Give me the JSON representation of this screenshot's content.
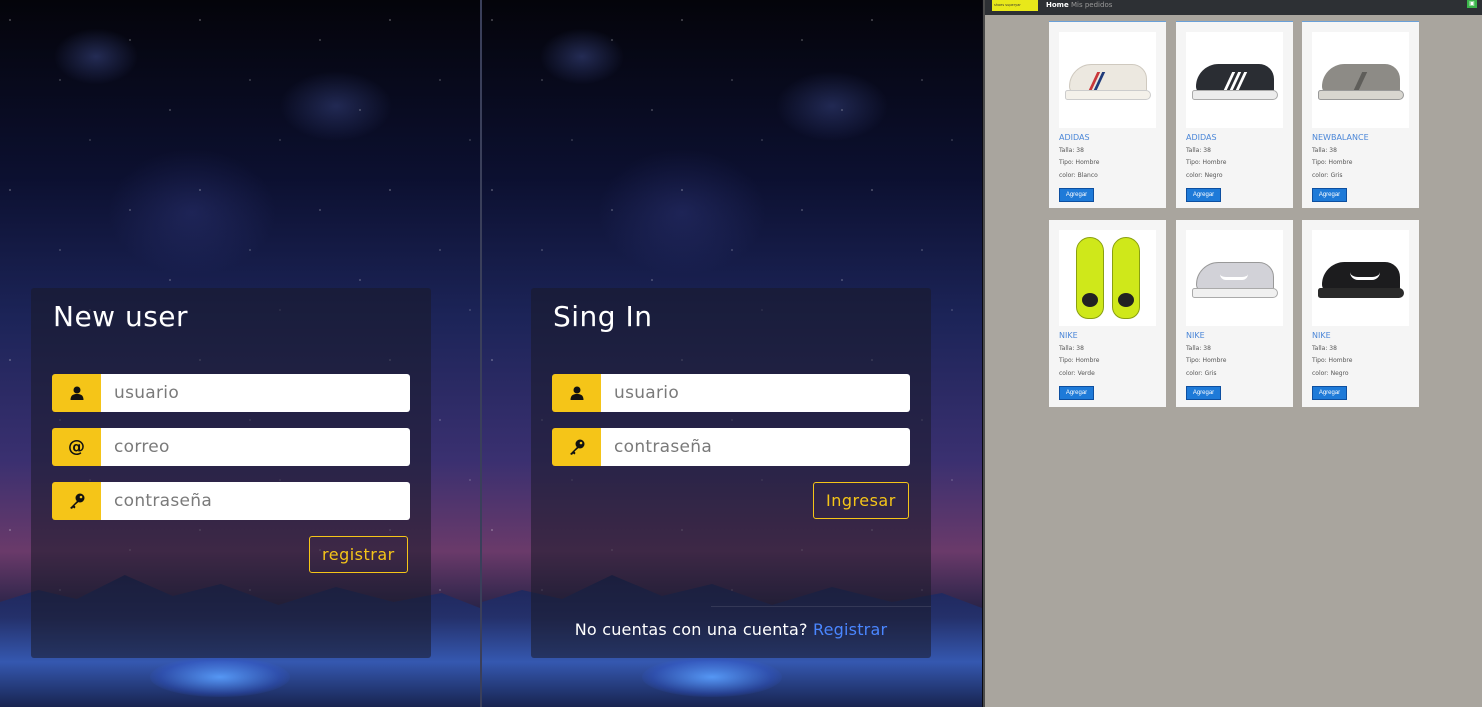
{
  "register": {
    "title": "New user",
    "username_placeholder": "usuario",
    "email_placeholder": "correo",
    "password_placeholder": "contraseña",
    "submit_label": "registrar"
  },
  "login": {
    "title": "Sing In",
    "username_placeholder": "usuario",
    "password_placeholder": "contraseña",
    "submit_label": "Ingresar",
    "footer_text": "No cuentas con una cuenta?",
    "footer_link": "Registrar"
  },
  "shop": {
    "brand_text": "shoes superyar",
    "nav": [
      {
        "label": "Home",
        "active": true
      },
      {
        "label": "Mis pedidos",
        "active": false
      }
    ],
    "cart_icon": "shopping-cart-icon",
    "add_label": "Agregar",
    "products": [
      {
        "brand": "ADIDAS",
        "talla": "Talla: 38",
        "tipo": "Tipo: Hombre",
        "color": "color: Blanco"
      },
      {
        "brand": "ADIDAS",
        "talla": "Talla: 38",
        "tipo": "Tipo: Hombre",
        "color": "color: Negro"
      },
      {
        "brand": "NEWBALANCE",
        "talla": "Talla: 38",
        "tipo": "Tipo: Hombre",
        "color": "color: Gris"
      },
      {
        "brand": "NIKE",
        "talla": "Talla: 38",
        "tipo": "Tipo: Hombre",
        "color": "color: Verde"
      },
      {
        "brand": "NIKE",
        "talla": "Talla: 38",
        "tipo": "Tipo: Hombre",
        "color": "color: Gris"
      },
      {
        "brand": "NIKE",
        "talla": "Talla: 38",
        "tipo": "Tipo: Hombre",
        "color": "color: Negro"
      }
    ]
  },
  "colors": {
    "accent": "#f5c518",
    "link": "#4a86ff",
    "button_blue": "#1e7ad8",
    "shop_bg": "#a9a59e"
  }
}
